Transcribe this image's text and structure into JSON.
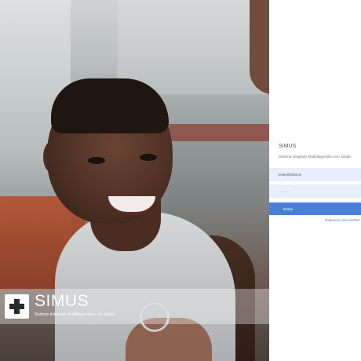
{
  "brand": {
    "logo_icon": "medical-cross-icon",
    "name": "SIMUS",
    "subtitle": "Sistema Integrado Multidiagnóstico em Saúde"
  },
  "login": {
    "title": "SIMUS",
    "subtitle": "Sistema Integrado Multidiagnóstico em Saúde",
    "email_value": "teste@teste.te",
    "password_value": "........",
    "enter_label": "Entrar",
    "forgot_label": "Esqueceu sua senha?"
  },
  "colors": {
    "accent": "#4a7fd8",
    "field_bg": "#e8eefb"
  }
}
